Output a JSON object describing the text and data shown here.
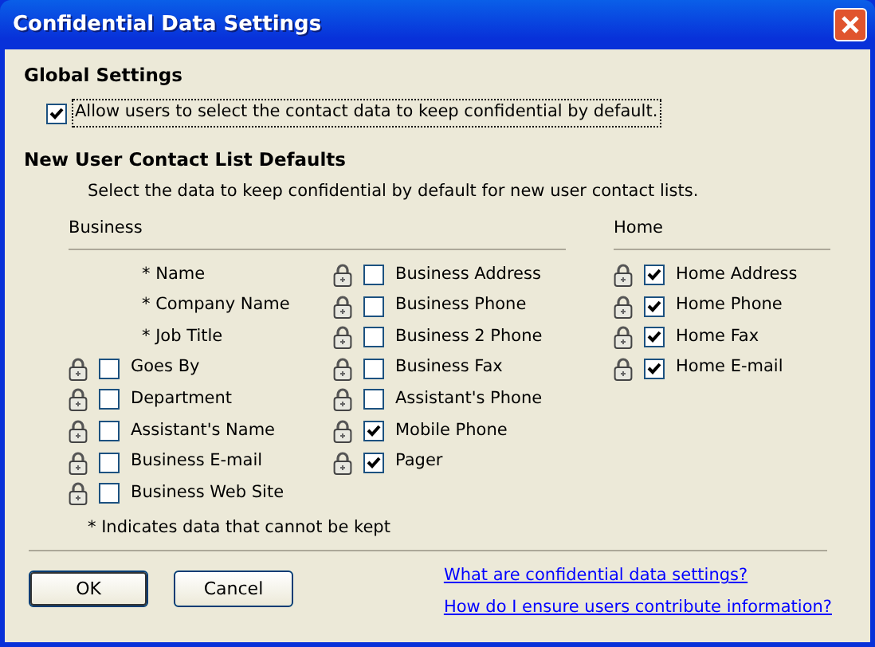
{
  "window": {
    "title": "Confidential Data Settings"
  },
  "global_settings": {
    "heading": "Global Settings",
    "option": {
      "label": "Allow users to select the contact data to keep confidential by default.",
      "checked": true
    }
  },
  "defaults": {
    "heading": "New User Contact List Defaults",
    "instruction": "Select the data to keep confidential by default for new user contact lists.",
    "groups": [
      {
        "title": "Business",
        "columns": [
          [
            {
              "kind": "fixed",
              "label": "* Name"
            },
            {
              "kind": "fixed",
              "label": "* Company Name"
            },
            {
              "kind": "fixed",
              "label": "* Job Title"
            },
            {
              "kind": "option",
              "label": "Goes By",
              "checked": false
            },
            {
              "kind": "option",
              "label": "Department",
              "checked": false
            },
            {
              "kind": "option",
              "label": "Assistant's Name",
              "checked": false
            },
            {
              "kind": "option",
              "label": "Business E-mail",
              "checked": false
            },
            {
              "kind": "option",
              "label": "Business Web Site",
              "checked": false
            }
          ],
          [
            {
              "kind": "option",
              "label": "Business Address",
              "checked": false
            },
            {
              "kind": "option",
              "label": "Business Phone",
              "checked": false
            },
            {
              "kind": "option",
              "label": "Business 2 Phone",
              "checked": false
            },
            {
              "kind": "option",
              "label": "Business Fax",
              "checked": false
            },
            {
              "kind": "option",
              "label": "Assistant's Phone",
              "checked": false
            },
            {
              "kind": "option",
              "label": "Mobile Phone",
              "checked": true
            },
            {
              "kind": "option",
              "label": "Pager",
              "checked": true
            }
          ]
        ]
      },
      {
        "title": "Home",
        "columns": [
          [
            {
              "kind": "option",
              "label": "Home Address",
              "checked": true
            },
            {
              "kind": "option",
              "label": "Home Phone",
              "checked": true
            },
            {
              "kind": "option",
              "label": "Home Fax",
              "checked": true
            },
            {
              "kind": "option",
              "label": "Home E-mail",
              "checked": true
            }
          ]
        ]
      }
    ],
    "footnote": "* Indicates data that cannot be kept"
  },
  "buttons": [
    {
      "label": "OK",
      "default": true
    },
    {
      "label": "Cancel",
      "default": false
    }
  ],
  "links": [
    "What are confidential data settings?",
    "How do I ensure users contribute information?"
  ]
}
